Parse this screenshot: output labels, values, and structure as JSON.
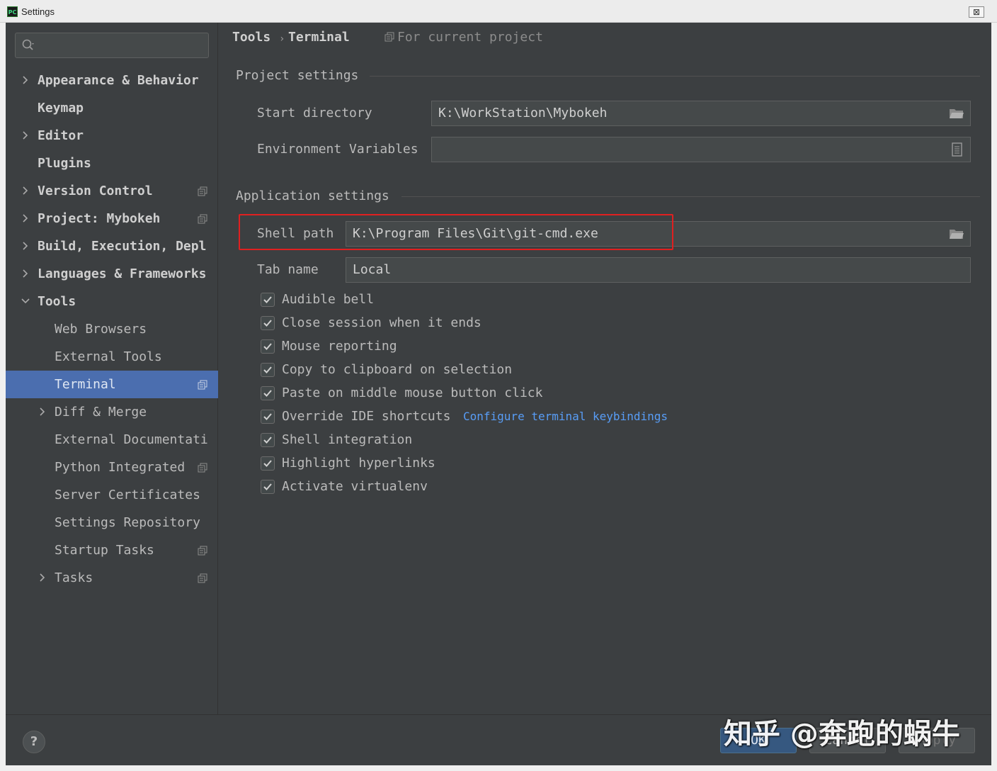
{
  "window": {
    "title": "Settings",
    "logo_text": "PC",
    "close_symbol": "⊠"
  },
  "search": {
    "placeholder": ""
  },
  "sidebar": {
    "items": [
      {
        "label": "Appearance & Behavior",
        "expandable": true,
        "expanded": false,
        "project_scoped": false
      },
      {
        "label": "Keymap",
        "expandable": false,
        "project_scoped": false
      },
      {
        "label": "Editor",
        "expandable": true,
        "expanded": false,
        "project_scoped": false
      },
      {
        "label": "Plugins",
        "expandable": false,
        "project_scoped": false
      },
      {
        "label": "Version Control",
        "expandable": true,
        "expanded": false,
        "project_scoped": true
      },
      {
        "label": "Project: Mybokeh",
        "expandable": true,
        "expanded": false,
        "project_scoped": true
      },
      {
        "label": "Build, Execution, Depl",
        "expandable": true,
        "expanded": false,
        "project_scoped": false
      },
      {
        "label": "Languages & Frameworks",
        "expandable": true,
        "expanded": false,
        "project_scoped": false
      },
      {
        "label": "Tools",
        "expandable": true,
        "expanded": true,
        "project_scoped": false
      },
      {
        "label": "Web Browsers",
        "child": true,
        "project_scoped": false
      },
      {
        "label": "External Tools",
        "child": true,
        "project_scoped": false
      },
      {
        "label": "Terminal",
        "child": true,
        "selected": true,
        "project_scoped": true
      },
      {
        "label": "Diff & Merge",
        "child": true,
        "expandable": true,
        "project_scoped": false
      },
      {
        "label": "External Documentati",
        "child": true,
        "project_scoped": false
      },
      {
        "label": "Python Integrated",
        "child": true,
        "project_scoped": true
      },
      {
        "label": "Server Certificates",
        "child": true,
        "project_scoped": false
      },
      {
        "label": "Settings Repository",
        "child": true,
        "project_scoped": false
      },
      {
        "label": "Startup Tasks",
        "child": true,
        "project_scoped": true
      },
      {
        "label": "Tasks",
        "child": true,
        "expandable": true,
        "project_scoped": true
      }
    ]
  },
  "breadcrumb": {
    "parent": "Tools",
    "separator": "›",
    "current": "Terminal",
    "scope": "For current project"
  },
  "project_settings": {
    "title": "Project settings",
    "start_directory": {
      "label": "Start directory",
      "value": "K:\\WorkStation\\Mybokeh"
    },
    "env_vars": {
      "label": "Environment Variables",
      "value": ""
    }
  },
  "application_settings": {
    "title": "Application settings",
    "shell_path": {
      "label": "Shell path",
      "value": "K:\\Program Files\\Git\\git-cmd.exe"
    },
    "tab_name": {
      "label": "Tab name",
      "value": "Local"
    },
    "checkboxes": [
      {
        "label": "Audible bell",
        "checked": true
      },
      {
        "label": "Close session when it ends",
        "checked": true
      },
      {
        "label": "Mouse reporting",
        "checked": true
      },
      {
        "label": "Copy to clipboard on selection",
        "checked": true
      },
      {
        "label": "Paste on middle mouse button click",
        "checked": true
      },
      {
        "label": "Override IDE shortcuts",
        "checked": true
      },
      {
        "label": "Shell integration",
        "checked": true
      },
      {
        "label": "Highlight hyperlinks",
        "checked": true
      },
      {
        "label": "Activate virtualenv",
        "checked": true
      }
    ],
    "keybindings_link": "Configure terminal keybindings"
  },
  "footer": {
    "help": "?",
    "ok": "OK",
    "cancel": "Cancel",
    "apply": "Apply"
  },
  "watermark": "知乎 @奔跑的蜗牛",
  "colors": {
    "selection": "#4b6eaf",
    "link": "#589df6",
    "highlight_box": "#e02020",
    "ok_button": "#365880"
  }
}
